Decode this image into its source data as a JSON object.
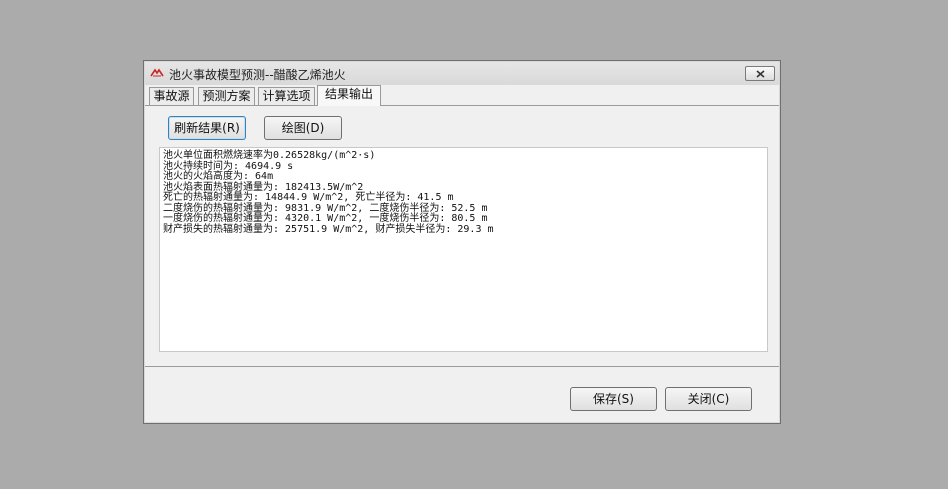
{
  "window": {
    "title": "池火事故模型预测--醋酸乙烯池火",
    "icon": "app-logo-icon",
    "close_icon": "close-icon"
  },
  "tabs": [
    {
      "label": "事故源"
    },
    {
      "label": "预测方案"
    },
    {
      "label": "计算选项"
    },
    {
      "label": "结果输出",
      "active": true
    }
  ],
  "toolbar": {
    "refresh_label": "刷新结果(R)",
    "plot_label": "绘图(D)"
  },
  "output": {
    "lines": [
      "池火单位面积燃烧速率为0.26528kg/(m^2·s)",
      "池火持续时间为: 4694.9 s",
      "池火的火焰高度为: 64m",
      "池火焰表面热辐射通量为: 182413.5W/m^2",
      "死亡的热辐射通量为: 14844.9 W/m^2, 死亡半径为: 41.5 m",
      "二度烧伤的热辐射通量为: 9831.9 W/m^2, 二度烧伤半径为: 52.5 m",
      "一度烧伤的热辐射通量为: 4320.1 W/m^2, 一度烧伤半径为: 80.5 m",
      "财产损失的热辐射通量为: 25751.9 W/m^2, 财产损失半径为: 29.3 m"
    ]
  },
  "footer": {
    "save_label": "保存(S)",
    "close_label": "关闭(C)"
  }
}
